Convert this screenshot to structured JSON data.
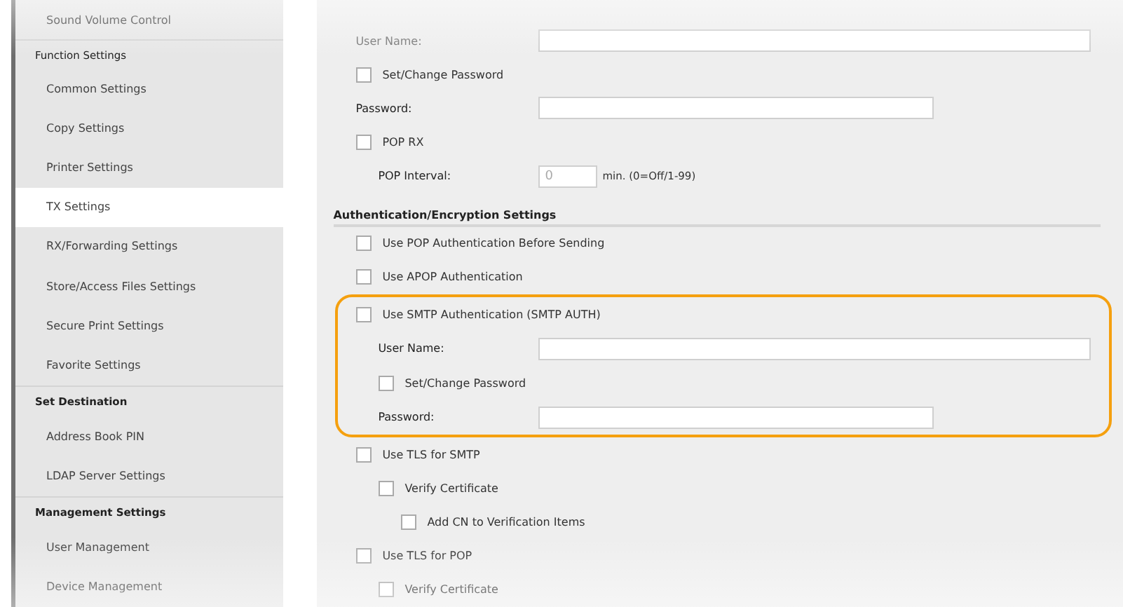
{
  "sidebar": {
    "items": [
      {
        "kind": "item",
        "label": "Sound Volume Control",
        "selected": false
      },
      {
        "kind": "heading",
        "label": "Function Settings"
      },
      {
        "kind": "item",
        "label": "Common Settings",
        "selected": false
      },
      {
        "kind": "item",
        "label": "Copy Settings",
        "selected": false
      },
      {
        "kind": "item",
        "label": "Printer Settings",
        "selected": false
      },
      {
        "kind": "item",
        "label": "TX Settings",
        "selected": true
      },
      {
        "kind": "item",
        "label": "RX/Forwarding Settings",
        "selected": false
      },
      {
        "kind": "item",
        "label": "Store/Access Files Settings",
        "selected": false
      },
      {
        "kind": "item",
        "label": "Secure Print Settings",
        "selected": false
      },
      {
        "kind": "item",
        "label": "Favorite Settings",
        "selected": false
      },
      {
        "kind": "heading",
        "label": "Set Destination"
      },
      {
        "kind": "item",
        "label": "Address Book PIN",
        "selected": false
      },
      {
        "kind": "item",
        "label": "LDAP Server Settings",
        "selected": false
      },
      {
        "kind": "heading",
        "label": "Management Settings"
      },
      {
        "kind": "item",
        "label": "User Management",
        "selected": false
      },
      {
        "kind": "item",
        "label": "Device Management",
        "selected": false
      }
    ]
  },
  "settings": {
    "rows": [
      {
        "kind": "group",
        "children": [
          {
            "kind": "text-field",
            "label": "User Name:",
            "disabled": true
          },
          {
            "kind": "checkbox",
            "label": "Set/Change Password",
            "checked": false,
            "highlighted": false
          },
          {
            "kind": "password-field",
            "label": "Password:",
            "disabled": false
          }
        ]
      },
      {
        "kind": "checkbox",
        "label": "POP RX",
        "checked": false,
        "highlighted": false,
        "children": [
          {
            "kind": "interval",
            "label": "POP Interval:",
            "value": "0",
            "hint": "min. (0=Off/1-99)"
          }
        ]
      },
      {
        "kind": "heading",
        "label": "Authentication/Encryption Settings"
      },
      {
        "kind": "checkbox",
        "label": "Use POP Authentication Before Sending",
        "checked": false,
        "highlighted": false
      },
      {
        "kind": "checkbox",
        "label": "Use APOP Authentication",
        "checked": false,
        "highlighted": false
      },
      {
        "kind": "checkbox",
        "label": "Use SMTP Authentication (SMTP AUTH)",
        "checked": false,
        "highlighted": true,
        "children": [
          {
            "kind": "text-field",
            "label": "User Name:",
            "disabled": false
          },
          {
            "kind": "checkbox",
            "label": "Set/Change Password",
            "checked": false,
            "highlighted": false
          },
          {
            "kind": "password-field",
            "label": "Password:",
            "disabled": false
          }
        ]
      },
      {
        "kind": "checkbox",
        "label": "Use TLS for SMTP",
        "checked": false,
        "highlighted": false,
        "children": [
          {
            "kind": "checkbox",
            "label": "Verify Certificate",
            "checked": false,
            "highlighted": false,
            "children": [
              {
                "kind": "checkbox",
                "label": "Add CN to Verification Items",
                "checked": false,
                "highlighted": false
              }
            ]
          }
        ]
      },
      {
        "kind": "checkbox",
        "label": "Use TLS for POP",
        "checked": false,
        "highlighted": false,
        "children": [
          {
            "kind": "checkbox",
            "label": "Verify Certificate",
            "checked": false,
            "highlighted": false
          }
        ]
      }
    ]
  }
}
